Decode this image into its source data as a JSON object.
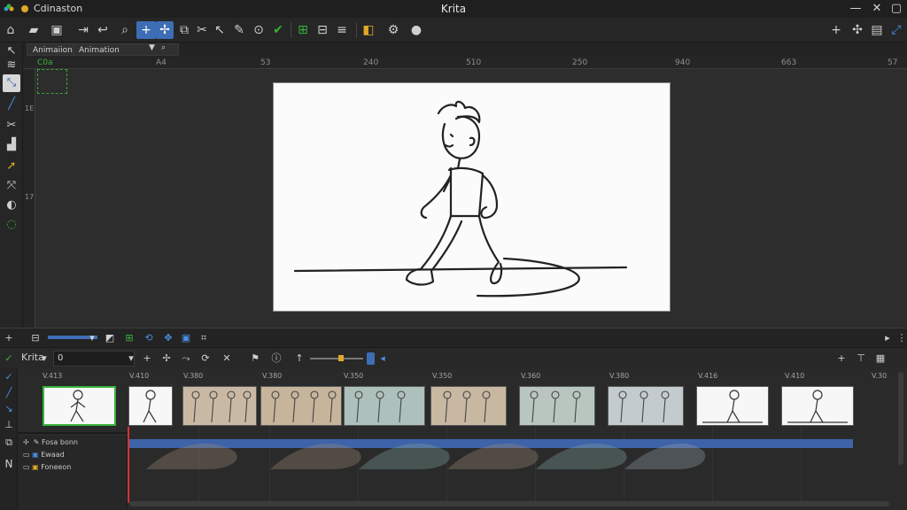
{
  "window": {
    "title": "Krita",
    "document_name": "Cdinaston",
    "minimize": "—",
    "close": "✕"
  },
  "toolbar": {
    "icons": [
      "home-icon",
      "folder-icon",
      "save-icon",
      "export-icon",
      "undo-icon",
      "zoom-icon",
      "add-icon",
      "transform-icon",
      "align-icon",
      "cut-icon",
      "pointer-icon",
      "brush-icon",
      "search-icon",
      "onion-icon",
      "grid-icon",
      "layout-icon",
      "menu-icon",
      "frame-icon",
      "settings-icon",
      "sphere-icon"
    ],
    "right_icons": [
      "add-icon",
      "transform-icon",
      "pin-icon",
      "dock-icon"
    ]
  },
  "tabs": {
    "tab1": "Animaiion",
    "tab2": "Animation"
  },
  "ruler": {
    "ticks": [
      "C0a",
      "A4",
      "53",
      "240",
      "510",
      "250",
      "940",
      "663",
      "57"
    ]
  },
  "vruler": {
    "ticks": [
      "1E",
      "17"
    ]
  },
  "timeline_bar": {
    "layer_name": "Krita",
    "frame_value": "0"
  },
  "frames": {
    "labels": [
      "V.413",
      "V.410",
      "V.380",
      "V.380",
      "V.350",
      "V.350",
      "V.360",
      "V.380",
      "V.416",
      "V.410",
      "V.30"
    ]
  },
  "layers": [
    {
      "name": "Fosa bonn"
    },
    {
      "name": "Ewaad"
    },
    {
      "name": "Foneeon"
    }
  ],
  "left_panel": {
    "n_label": "N"
  },
  "colors": {
    "accent": "#3d6db5",
    "current_frame_border": "#38b23a",
    "playhead": "#d23333",
    "track": "#3f63a8"
  }
}
